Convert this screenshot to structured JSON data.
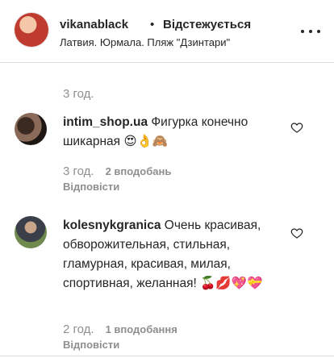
{
  "header": {
    "username": "vikanablack",
    "separator": "•",
    "follow_label": "Відстежується",
    "location": "Латвия. Юрмала. Пляж \"Дзинтари\""
  },
  "top_timestamp": "3 год.",
  "comments": [
    {
      "username": "intim_shop.ua",
      "text": "Фигурка конечно шикарная",
      "emoji": "😍👌🙈",
      "time": "3 год.",
      "likes": "2 вподобань",
      "reply_label": "Відповісти"
    },
    {
      "username": "kolesnykgranica",
      "text": "Очень красивая, обворожительная, стильная, гламурная, красивая, милая, спортивная, желанная!",
      "emoji": "🍒💋💖💝",
      "time": "2 год.",
      "likes": "1 вподобання",
      "reply_label": "Відповісти"
    }
  ],
  "colors": {
    "text": "#262626",
    "secondary": "#8e8e8e",
    "divider": "#dbdbdb"
  }
}
